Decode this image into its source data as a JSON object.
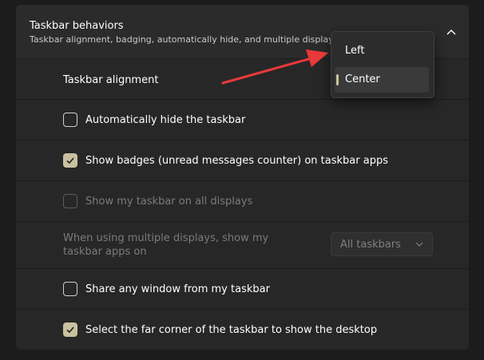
{
  "section": {
    "title": "Taskbar behaviors",
    "subtitle": "Taskbar alignment, badging, automatically hide, and multiple displays",
    "expanded": true
  },
  "rows": {
    "alignment": {
      "label": "Taskbar alignment"
    },
    "auto_hide": {
      "label": "Automatically hide the taskbar",
      "checked": false
    },
    "badges": {
      "label": "Show badges (unread messages counter) on taskbar apps",
      "checked": true
    },
    "all_displays": {
      "label": "Show my taskbar on all displays",
      "checked": false,
      "disabled": true
    },
    "multi_display": {
      "label": "When using multiple displays, show my taskbar apps on",
      "dropdown_value": "All taskbars",
      "disabled": true
    },
    "share_window": {
      "label": "Share any window from my taskbar",
      "checked": false
    },
    "far_corner": {
      "label": "Select the far corner of the taskbar to show the desktop",
      "checked": true
    }
  },
  "alignment_menu": {
    "options": [
      "Left",
      "Center"
    ],
    "selected": "Center"
  },
  "colors": {
    "accent": "#c9c19f",
    "annotation_arrow": "#e8393b"
  },
  "icons": {
    "collapse": "chevron-up-icon",
    "dropdown": "chevron-down-icon",
    "check": "checkmark-icon"
  }
}
